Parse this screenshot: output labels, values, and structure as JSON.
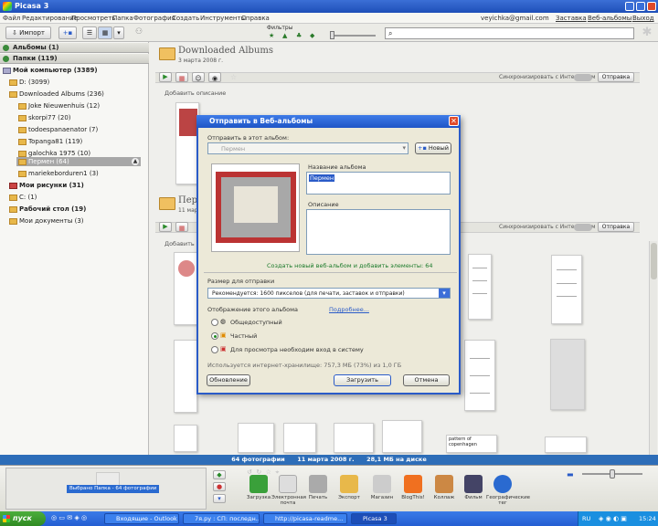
{
  "window": {
    "title": "Picasa 3"
  },
  "menu": {
    "items": [
      "Файл",
      "Редактирование",
      "Просмотреть",
      "Папка",
      "Фотография",
      "Создать",
      "Инструменты",
      "Справка"
    ],
    "account": "veyichka@gmail.com",
    "links": [
      "Заставка",
      "Веб-альбомы",
      "Выход"
    ]
  },
  "toolbar": {
    "import_label": "Импорт",
    "filters_label": "Фильтры",
    "search_placeholder": ""
  },
  "left_panel": {
    "albums_header": "Альбомы (1)",
    "folders_header": "Папки (119)",
    "my_computer": "Мой компьютер (3389)",
    "items": [
      {
        "label": "D: (3099)",
        "indent": 1
      },
      {
        "label": "Downloaded Albums (236)",
        "indent": 1
      },
      {
        "label": "Joke Nieuwenhuis (12)",
        "indent": 2
      },
      {
        "label": "skorpi77 (20)",
        "indent": 2
      },
      {
        "label": "todoespanaenator (7)",
        "indent": 2
      },
      {
        "label": "Topanga81 (119)",
        "indent": 2
      },
      {
        "label": "galochka 1975 (10)",
        "indent": 2
      },
      {
        "label": "Пермен (64)",
        "indent": 2,
        "selected": true
      },
      {
        "label": "mariekeborduren1 (3)",
        "indent": 2
      },
      {
        "label": "Мои рисунки (31)",
        "indent": 1,
        "bold": true
      },
      {
        "label": "C: (1)",
        "indent": 1
      },
      {
        "label": "Рабочий стол (19)",
        "indent": 1,
        "bold": true
      },
      {
        "label": "Мои документы (3)",
        "indent": 1
      }
    ]
  },
  "main": {
    "album1": {
      "title": "Downloaded Albums",
      "date": "3 марта 2008 г.",
      "add_description": "Добавить описание",
      "sync_label": "Синхронизировать с Интернетом",
      "send_label": "Отправка"
    },
    "album2": {
      "title": "Пермен",
      "date": "11 марта",
      "add_description": "Добавить описание",
      "sync_label": "Синхронизировать с Интернетом",
      "send_label": "Отправка"
    },
    "thumb_caption": "pattern of copenhagen"
  },
  "dialog": {
    "title": "Отправить в Веб-альбомы",
    "send_to_label": "Отправить в этот альбом:",
    "album_select_value": "Пермен",
    "new_button": "Новый",
    "album_name_label": "Название альбома",
    "album_name_value": "Пермен",
    "description_label": "Описание",
    "create_hint": "Создать новый веб-альбом и добавить элементы: 64",
    "size_label": "Размер для отправки",
    "size_value": "Рекомендуется: 1600 пикселов (для печати, заставок и отправки)",
    "visibility_label": "Отображение этого альбома",
    "more_link": "Подробнее...",
    "options": [
      "Общедоступный",
      "Частный",
      "Для просмотра необходим вход в систему"
    ],
    "storage_text": "Используется интернет-хранилище: 757,3 МБ (73%) из 1,0 ГБ",
    "update_button": "Обновление",
    "upload_button": "Загрузить",
    "cancel_button": "Отмена"
  },
  "status": {
    "photos": "64 фотографии",
    "date": "11 марта 2008 г.",
    "size": "28,1 МБ на диске"
  },
  "tray": {
    "selection_label": "Выбрано Папка - 64 фотографии",
    "items": [
      "Загрузка",
      "Электронная почта",
      "Печать",
      "Экспорт",
      "Магазин",
      "BlogThis!",
      "Коллаж",
      "Фильм",
      "Географические тег"
    ]
  },
  "taskbar": {
    "start": "пуск",
    "tasks": [
      "Входящие - Outlook ...",
      "7я.ру : СП: последн...",
      "http://picasa-readme...",
      "Picasa 3"
    ],
    "lang": "RU",
    "clock": "15:24"
  },
  "colors": {
    "titlebar": "#1e4fb8",
    "status": "#2d6db8",
    "taskbar": "#245ed2",
    "start": "#2f8a22",
    "dialog_border": "#2a5bc8"
  }
}
